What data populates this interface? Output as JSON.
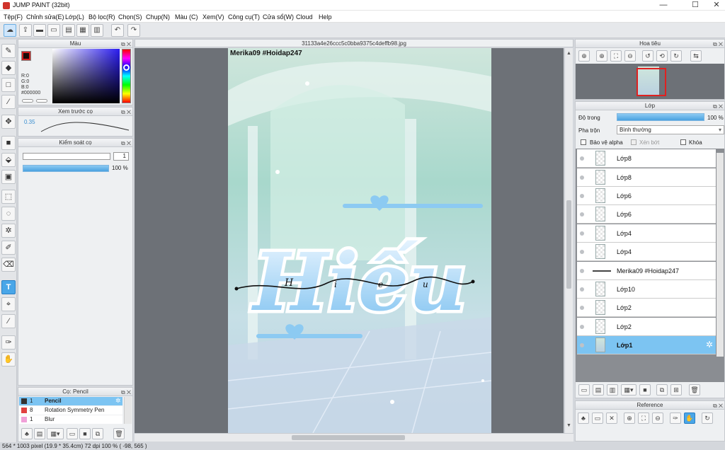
{
  "app": {
    "title": "JUMP PAINT (32bit)"
  },
  "window_controls": {
    "minimize": "—",
    "maximize": "☐",
    "close": "✕"
  },
  "menu": [
    "Tệp(F)",
    "Chỉnh sửa(E)",
    "Lớp(L)",
    "Bộ lọc(R)",
    "Chọn(S)",
    "Chụp(N)",
    "Màu (C)",
    "Xem(V)",
    "Công cụ(T)",
    "Cửa sổ(W)",
    "Cloud",
    "Help"
  ],
  "document": {
    "filename": "31133a4e26ccc5c0bba9375c4deffb98.jpg"
  },
  "artwork": {
    "watermark": "Merika09 #Hoidap247",
    "big_text": "Hiếu",
    "script_letters": [
      "H",
      "i",
      "e",
      "u"
    ]
  },
  "color_panel": {
    "title": "Màu",
    "r": "R:0",
    "g": "G:0",
    "b": "B:0",
    "hex": "#000000",
    "main_color": "#1a0a08",
    "sub_color": "#ffffff"
  },
  "brush_preview": {
    "title": "Xem trước cọ",
    "size": "0.35"
  },
  "brush_control": {
    "title": "Kiểm soát cọ",
    "size_value": "1",
    "opacity": "100 %"
  },
  "brush_list": {
    "title": "Cọ: Pencil",
    "items": [
      {
        "num": "1",
        "name": "Pencil",
        "color": "#333333"
      },
      {
        "num": "8",
        "name": "Rotation Symmetry Pen",
        "color": "#e04040"
      },
      {
        "num": "1",
        "name": "Blur",
        "color": "#f0a0d8"
      }
    ]
  },
  "navigator": {
    "title": "Hoa tiêu"
  },
  "layer_panel": {
    "title": "Lớp",
    "opacity_label": "Độ trong",
    "opacity_value": "100 %",
    "blend_label": "Pha trộn",
    "blend_value": "Bình thường",
    "protect_alpha": "Bảo vệ alpha",
    "clipping": "Xén bớt",
    "lock": "Khóa",
    "layers": [
      {
        "name": "Lớp8",
        "selected": false
      },
      {
        "name": "Lớp8",
        "selected": false
      },
      {
        "name": "Lớp6",
        "selected": false
      },
      {
        "name": "Lớp6",
        "selected": false
      },
      {
        "name": "Lớp4",
        "selected": false
      },
      {
        "name": "Lớp4",
        "selected": false
      },
      {
        "name": "Merika09 #Hoidap247",
        "selected": false
      },
      {
        "name": "Lớp10",
        "selected": false
      },
      {
        "name": "Lớp2",
        "selected": false
      },
      {
        "name": "Lớp2",
        "selected": false
      },
      {
        "name": "Lớp1",
        "selected": true
      }
    ]
  },
  "reference_panel": {
    "title": "Reference"
  },
  "status": {
    "text": "564 * 1003 pixel   (19.9 * 35.4cm)   72 dpi   100 %   ( -98, 565 )"
  }
}
